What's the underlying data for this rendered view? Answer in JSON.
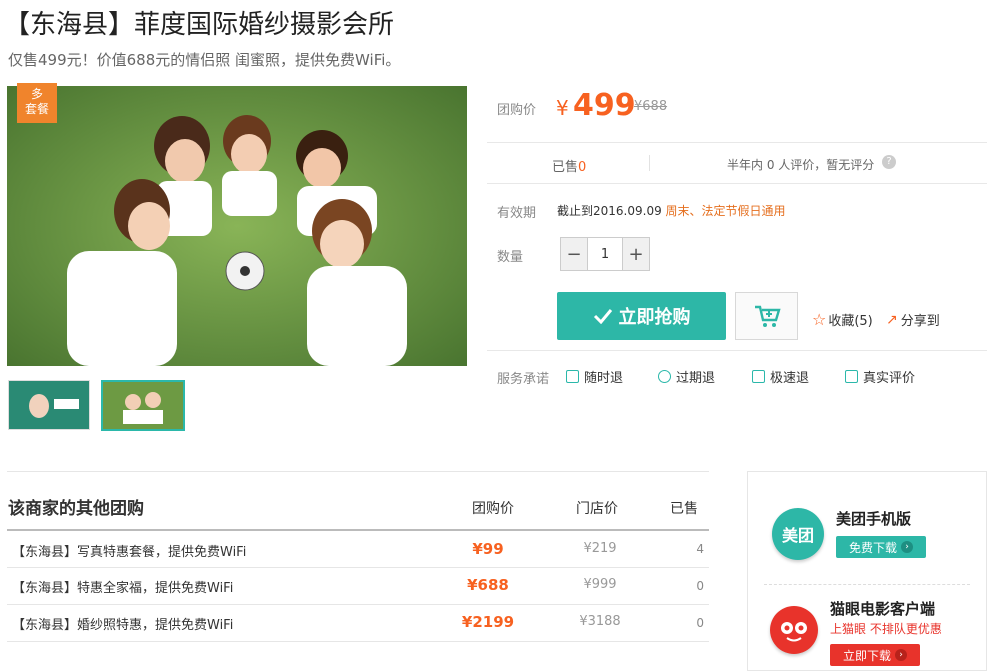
{
  "deal": {
    "title": "【东海县】菲度国际婚纱摄影会所",
    "subtitle": "仅售499元！价值688元的情侣照 闺蜜照，提供免费WiFi。",
    "badge_line1": "多",
    "badge_line2": "套餐"
  },
  "price_block": {
    "label": "团购价",
    "currency": "¥",
    "price": "499",
    "original": "¥688",
    "sold_label": "已售",
    "sold_count": "0",
    "rating_text": "半年内 0 人评价，暂无评分",
    "help": "?",
    "validity_label": "有效期",
    "validity_value": "截止到2016.09.09",
    "validity_note": "周末、法定节假日通用",
    "qty_label": "数量",
    "qty_minus": "−",
    "qty_value": "1",
    "qty_plus": "+",
    "buy_label": "立即抢购",
    "favorite": "收藏(5)",
    "share": "分享到",
    "service_label": "服务承诺",
    "services": [
      "随时退",
      "过期退",
      "极速退",
      "真实评价"
    ]
  },
  "other_deals": {
    "title": "该商家的其他团购",
    "headers": [
      "团购价",
      "门店价",
      "已售"
    ],
    "rows": [
      {
        "name": "【东海县】写真特惠套餐，提供免费WiFi",
        "price": "¥99",
        "orig": "¥219",
        "sold": "4"
      },
      {
        "name": "【东海县】特惠全家福，提供免费WiFi",
        "price": "¥688",
        "orig": "¥999",
        "sold": "0"
      },
      {
        "name": "【东海县】婚纱照特惠，提供免费WiFi",
        "price": "¥2199",
        "orig": "¥3188",
        "sold": "0"
      }
    ]
  },
  "sidebar": {
    "app1_icon": "美团",
    "app1_name": "美团手机版",
    "app1_btn": "免费下载",
    "app2_name": "猫眼电影客户端",
    "app2_slogan": "上猫眼 不排队更优惠",
    "app2_btn": "立即下载"
  },
  "colors": {
    "accent": "#2db7a7",
    "price": "#f76120",
    "badge": "#f0842c"
  }
}
